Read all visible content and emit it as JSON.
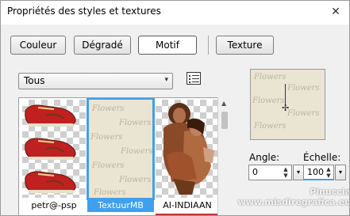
{
  "dialog": {
    "title": "Propriétés des styles et textures",
    "close_glyph": "✕"
  },
  "tabs": [
    {
      "label": "Couleur"
    },
    {
      "label": "Dégradé"
    },
    {
      "label": "Motif",
      "active": true
    },
    {
      "label": "Texture"
    }
  ],
  "category": {
    "selected": "Tous",
    "arrow": "▾"
  },
  "gallery": {
    "items": [
      {
        "label": "petr@-psp",
        "selected": false
      },
      {
        "label": "TextuurMB",
        "selected": true
      },
      {
        "label": "AI-INDIAAN",
        "selected": false
      }
    ],
    "texture_word": "Flowers"
  },
  "controls": {
    "angle_label": "Angle:",
    "angle_value": "0",
    "scale_label": "Échelle:",
    "scale_value": "100"
  },
  "watermark": {
    "line1": "Pinuccia",
    "line2": "www.misdiregrafica.eu"
  },
  "colors": {
    "selection_blue": "#3fa0ee",
    "texture_beige": "#eae4d3",
    "shoe_red": "#c02020"
  },
  "icons": {
    "close": "close-icon",
    "dropdown": "chevron-down-icon",
    "list_view": "list-view-icon",
    "crosshair": "crosshair-icon"
  }
}
